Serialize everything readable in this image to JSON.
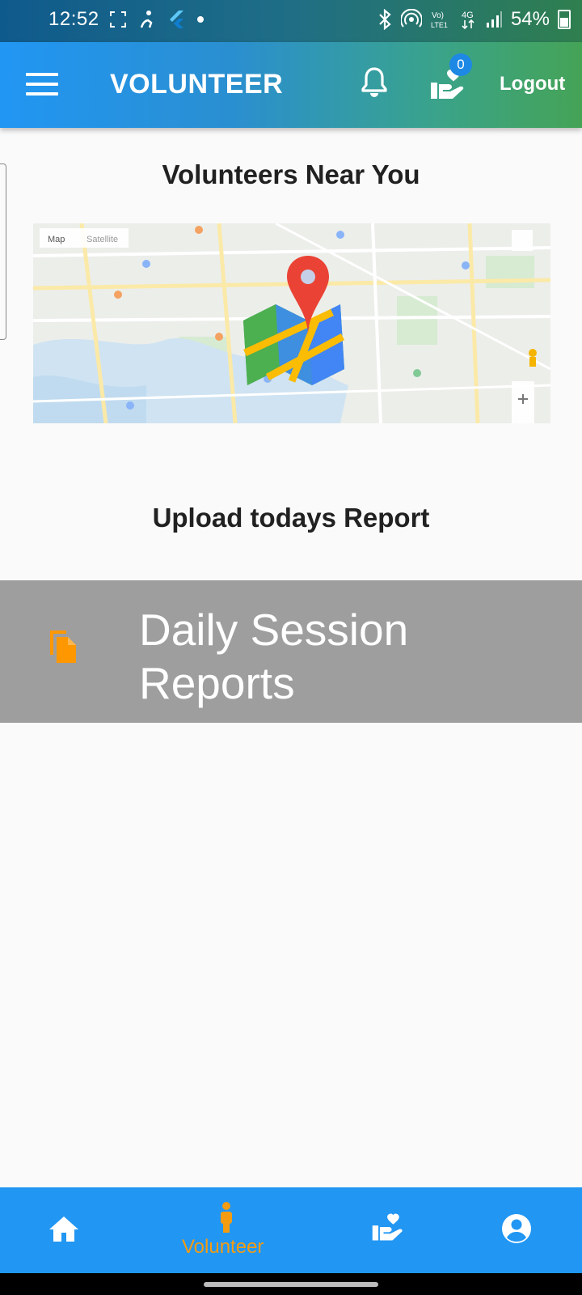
{
  "status_bar": {
    "time": "12:52",
    "battery": "54%"
  },
  "app_bar": {
    "title": "VOLUNTEER",
    "cart_badge": "0",
    "logout_label": "Logout"
  },
  "main": {
    "nearby_title": "Volunteers Near You",
    "upload_title": "Upload todays Report",
    "report_tile_label": "Daily Session Reports"
  },
  "bottom_nav": {
    "items": [
      {
        "icon": "home-icon",
        "label": ""
      },
      {
        "icon": "person-icon",
        "label": "Volunteer",
        "active": true
      },
      {
        "icon": "hand-heart-icon",
        "label": ""
      },
      {
        "icon": "account-icon",
        "label": ""
      }
    ]
  },
  "colors": {
    "primary": "#2196f3",
    "active": "#f39c12",
    "tile": "#9e9e9e"
  }
}
